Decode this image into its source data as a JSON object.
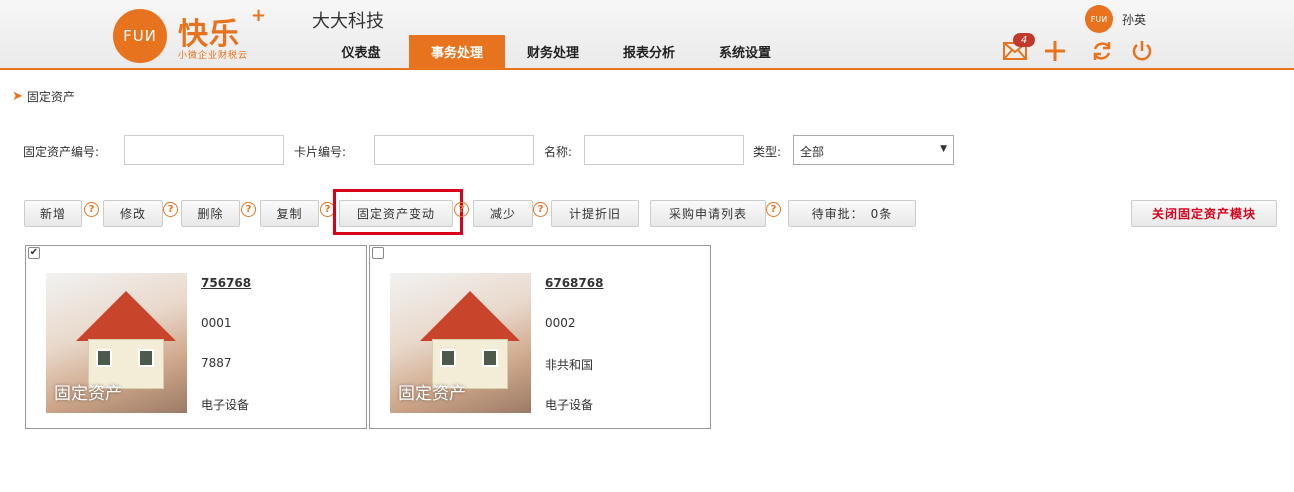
{
  "header": {
    "logo_circle_text": "FUИ",
    "logo_main": "快乐",
    "logo_plus": "+",
    "logo_sub": "小微企业财税云",
    "company": "大大科技",
    "nav": [
      {
        "label": "仪表盘",
        "active": false
      },
      {
        "label": "事务处理",
        "active": true
      },
      {
        "label": "财务处理",
        "active": false
      },
      {
        "label": "报表分析",
        "active": false
      },
      {
        "label": "系统设置",
        "active": false
      }
    ],
    "user_avatar_text": "FUИ",
    "user_name": "孙英",
    "mail_badge": "4",
    "icons": [
      "mail-icon",
      "plus-icon",
      "refresh-icon",
      "power-icon"
    ],
    "accent_color": "#e8731e"
  },
  "breadcrumb": "固定资产",
  "search": {
    "asset_no_label": "固定资产编号:",
    "card_no_label": "卡片编号:",
    "name_label": "名称:",
    "type_label": "类型:",
    "type_value": "全部",
    "asset_no_value": "",
    "card_no_value": "",
    "name_value": ""
  },
  "toolbar": {
    "add": "新增",
    "edit": "修改",
    "delete": "删除",
    "copy": "复制",
    "change": "固定资产变动",
    "reduce": "减少",
    "depreciation": "计提折旧",
    "purchase_list": "采购申请列表",
    "pending": "待审批：　0条",
    "help_glyph": "?",
    "close_module": "关闭固定资产模块"
  },
  "cards": [
    {
      "checked": true,
      "check_glyph": "✔",
      "caption": "固定资产",
      "code": "756768",
      "no": "0001",
      "name": "7887",
      "type": "电子设备"
    },
    {
      "checked": false,
      "check_glyph": "",
      "caption": "固定资产",
      "code": "6768768",
      "no": "0002",
      "name": "非共和国",
      "type": "电子设备"
    }
  ]
}
